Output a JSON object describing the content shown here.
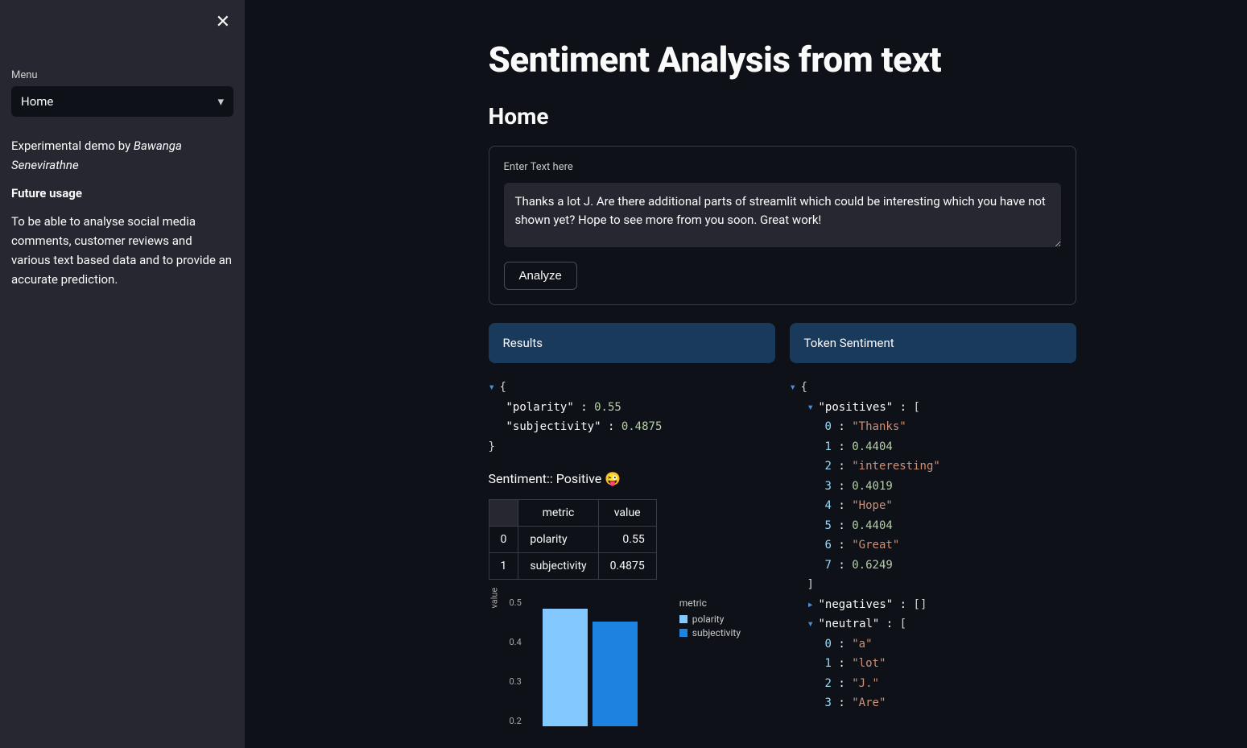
{
  "sidebar": {
    "menu_label": "Menu",
    "menu_value": "Home",
    "demo_prefix": "Experimental demo by ",
    "demo_author": "Bawanga Senevirathne",
    "future_heading": "Future usage",
    "future_body": "To be able to analyse social media comments, customer reviews and various text based data and to provide an accurate prediction."
  },
  "main": {
    "title": "Sentiment Analysis from text",
    "subtitle": "Home",
    "input_label": "Enter Text here",
    "input_value": "Thanks a lot J. Are there additional parts of streamlit which could be interesting which you have not shown yet? Hope to see more from you soon. Great work!",
    "analyze_label": "Analyze"
  },
  "results": {
    "banner": "Results",
    "json": {
      "polarity": 0.55,
      "subjectivity": 0.4875
    },
    "sentiment_text": "Sentiment:: Positive 😜",
    "table": {
      "headers": [
        "",
        "metric",
        "value"
      ],
      "rows": [
        [
          "0",
          "polarity",
          "0.55"
        ],
        [
          "1",
          "subjectivity",
          "0.4875"
        ]
      ]
    }
  },
  "token": {
    "banner": "Token Sentiment",
    "positives": [
      "Thanks",
      0.4404,
      "interesting",
      0.4019,
      "Hope",
      0.4404,
      "Great",
      0.6249
    ],
    "negatives": [],
    "neutral_start": [
      "a",
      "lot",
      "J.",
      "Are"
    ]
  },
  "chart_data": {
    "type": "bar",
    "legend_title": "metric",
    "ylabel": "value",
    "ylim": [
      0,
      0.6
    ],
    "yticks": [
      0.5,
      0.4,
      0.3,
      0.2
    ],
    "series": [
      {
        "name": "polarity",
        "value": 0.55,
        "color": "#83c9ff"
      },
      {
        "name": "subjectivity",
        "value": 0.4875,
        "color": "#1c83e1"
      }
    ]
  }
}
